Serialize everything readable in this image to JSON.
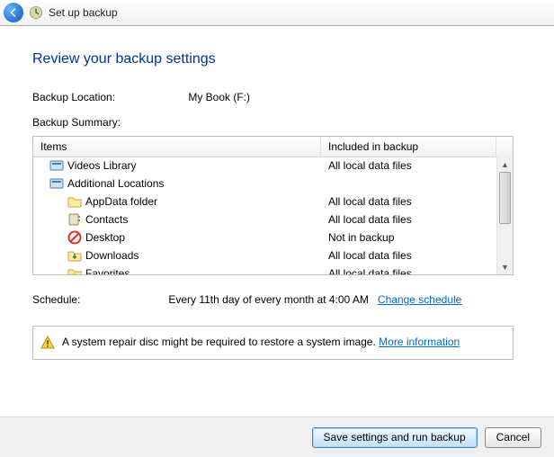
{
  "window": {
    "title": "Set up backup"
  },
  "heading": "Review your backup settings",
  "location": {
    "label": "Backup Location:",
    "value": "My Book (F:)"
  },
  "summary_label": "Backup Summary:",
  "columns": {
    "items": "Items",
    "included": "Included in backup"
  },
  "rows": [
    {
      "name": "Videos Library",
      "status": "All local data files",
      "indent": 1,
      "icon": "library"
    },
    {
      "name": "Additional Locations",
      "status": "",
      "indent": 1,
      "icon": "library"
    },
    {
      "name": "AppData folder",
      "status": "All local data files",
      "indent": 2,
      "icon": "folder"
    },
    {
      "name": "Contacts",
      "status": "All local data files",
      "indent": 2,
      "icon": "addressbook"
    },
    {
      "name": "Desktop",
      "status": "Not in backup",
      "indent": 2,
      "icon": "blocked"
    },
    {
      "name": "Downloads",
      "status": "All local data files",
      "indent": 2,
      "icon": "downloads"
    },
    {
      "name": "Favorites",
      "status": "All local data files",
      "indent": 2,
      "icon": "favorites"
    }
  ],
  "schedule": {
    "label": "Schedule:",
    "value": "Every 11th day of every month at 4:00 AM",
    "change_link": "Change schedule"
  },
  "warning": {
    "text": "A system repair disc might be required to restore a system image.",
    "link": "More information"
  },
  "buttons": {
    "save": "Save settings and run backup",
    "cancel": "Cancel"
  }
}
